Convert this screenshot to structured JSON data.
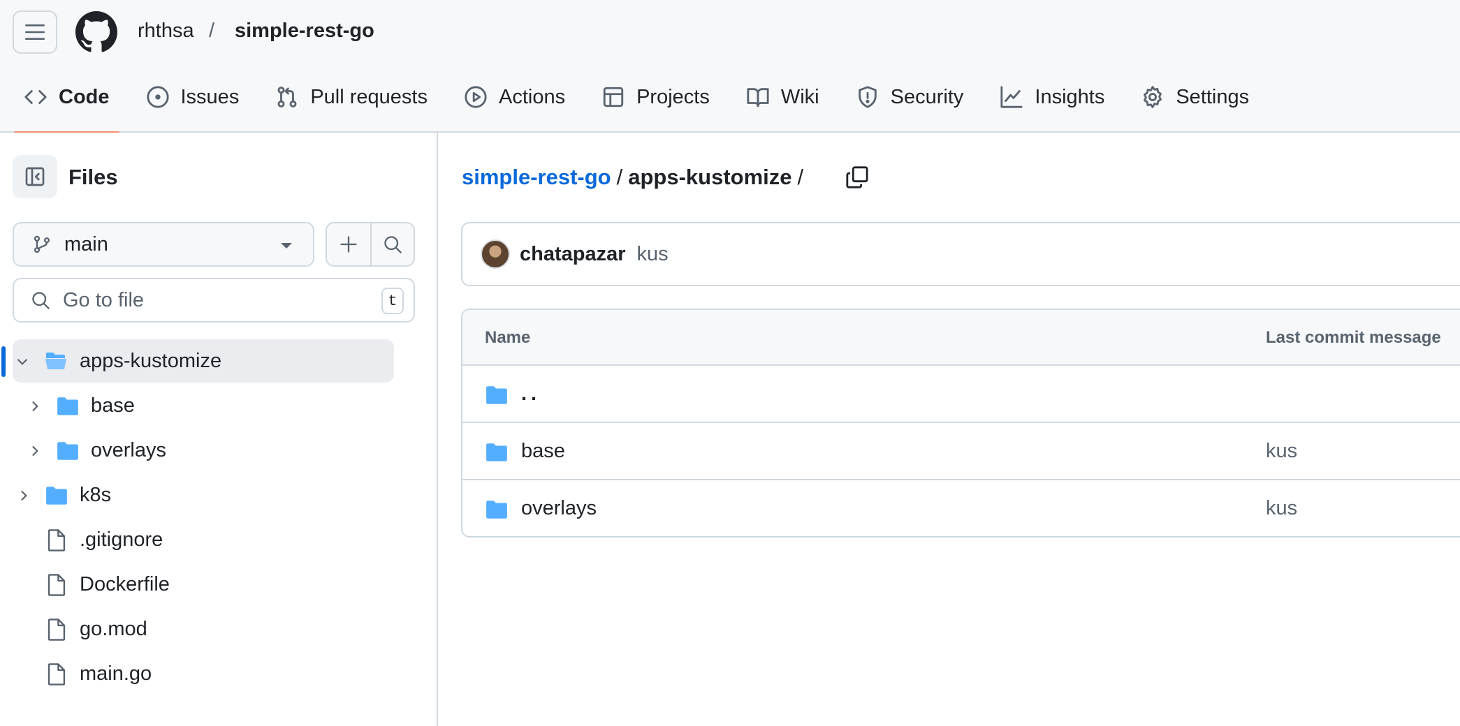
{
  "header": {
    "owner": "rhthsa",
    "separator": "/",
    "repo": "simple-rest-go",
    "tabs": [
      {
        "label": "Code",
        "icon": "code-icon",
        "active": true
      },
      {
        "label": "Issues",
        "icon": "issue-icon"
      },
      {
        "label": "Pull requests",
        "icon": "pull-request-icon"
      },
      {
        "label": "Actions",
        "icon": "play-icon"
      },
      {
        "label": "Projects",
        "icon": "table-icon"
      },
      {
        "label": "Wiki",
        "icon": "book-icon"
      },
      {
        "label": "Security",
        "icon": "shield-icon"
      },
      {
        "label": "Insights",
        "icon": "graph-icon"
      },
      {
        "label": "Settings",
        "icon": "gear-icon"
      }
    ]
  },
  "sidebar": {
    "title": "Files",
    "branch": "main",
    "goto_placeholder": "Go to file",
    "goto_shortcut": "t",
    "tree": [
      {
        "name": "apps-kustomize",
        "type": "folder-open",
        "level": 0,
        "expanded": true,
        "selected": true
      },
      {
        "name": "base",
        "type": "folder",
        "level": 1,
        "expanded": false
      },
      {
        "name": "overlays",
        "type": "folder",
        "level": 1,
        "expanded": false
      },
      {
        "name": "k8s",
        "type": "folder",
        "level": 0,
        "expanded": false
      },
      {
        "name": ".gitignore",
        "type": "file",
        "level": 0
      },
      {
        "name": "Dockerfile",
        "type": "file",
        "level": 0
      },
      {
        "name": "go.mod",
        "type": "file",
        "level": 0
      },
      {
        "name": "main.go",
        "type": "file",
        "level": 0
      }
    ]
  },
  "main": {
    "path_root": "simple-rest-go",
    "path_sep": "/",
    "path_current": "apps-kustomize",
    "path_trailing": "/",
    "commit": {
      "author": "chatapazar",
      "message": "kus"
    },
    "table": {
      "headers": {
        "name": "Name",
        "message": "Last commit message"
      },
      "rows": [
        {
          "name": "..",
          "message": ""
        },
        {
          "name": "base",
          "message": "kus"
        },
        {
          "name": "overlays",
          "message": "kus"
        }
      ]
    }
  },
  "colors": {
    "accent_link": "#0969da",
    "active_tab_underline": "#fd8c73",
    "folder": "#54aeff",
    "border": "#d1d9e0"
  }
}
